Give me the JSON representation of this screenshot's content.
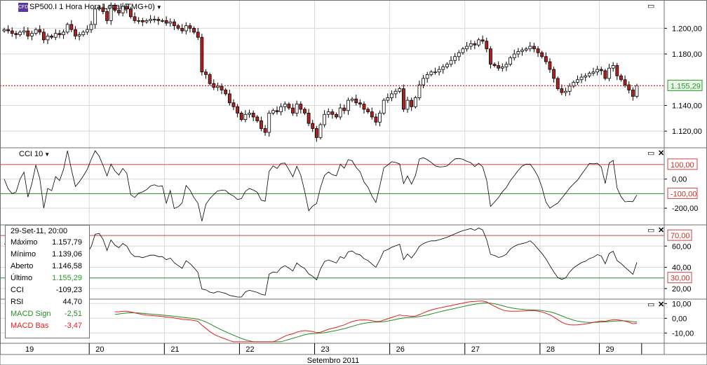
{
  "window": {
    "title": "SP500.I 1 Hora Hora Local (TMG+0)",
    "logo_label": "CFD"
  },
  "price_pane": {
    "last_price_label": "1.155,29"
  },
  "cci_pane": {
    "label": "CCI 10"
  },
  "info_box": {
    "header": "29-Set-11, 20:00",
    "rows": [
      {
        "label": "Máximo",
        "value": "1.157,79",
        "color": "#000000"
      },
      {
        "label": "Mínimo",
        "value": "1.139,06",
        "color": "#000000"
      },
      {
        "label": "Aberto",
        "value": "1.146,58",
        "color": "#000000"
      },
      {
        "label": "Último",
        "value": "1.155,29",
        "color": "#2a9a2a"
      },
      {
        "label": "CCI",
        "value": "-109,23",
        "color": "#000000"
      },
      {
        "label": "RSI",
        "value": "44,70",
        "color": "#000000"
      },
      {
        "label": "MACD Sign",
        "value": "-2,51",
        "color": "#2a8a2a",
        "label_color": "#2a8a2a"
      },
      {
        "label": "MACD Bas",
        "value": "-3,47",
        "color": "#e02020",
        "label_color": "#e02020"
      }
    ]
  },
  "colors": {
    "up_candle": "#ffffff",
    "down_candle": "#b02020",
    "ref_red": "#d04040",
    "ref_green": "#2a8a2a",
    "macd_signal": "#2a8a2a",
    "macd_base": "#e02020"
  },
  "chart_data": [
    {
      "type": "candlestick",
      "title": "SP500.I 1 Hora Hora Local (TMG+0)",
      "y_ticks": [
        "1.120,00",
        "1.140,00",
        "1.160,00",
        "1.180,00",
        "1.200,00"
      ],
      "ylim": [
        1107,
        1222
      ],
      "last_price": 1155.29,
      "x_labels": [
        "19",
        "20",
        "21",
        "22",
        "23",
        "26",
        "27",
        "28",
        "29"
      ],
      "x_title": "Setembro 2011",
      "close": [
        1199,
        1198,
        1196,
        1195,
        1197,
        1198,
        1194,
        1196,
        1199,
        1197,
        1191,
        1194,
        1193,
        1196,
        1195,
        1197,
        1203,
        1199,
        1194,
        1195,
        1197,
        1199,
        1203,
        1215,
        1216,
        1213,
        1206,
        1218,
        1214,
        1212,
        1217,
        1215,
        1209,
        1206,
        1206,
        1205,
        1206,
        1207,
        1207,
        1206,
        1206,
        1204,
        1205,
        1202,
        1200,
        1198,
        1202,
        1200,
        1197,
        1193,
        1166,
        1164,
        1157,
        1154,
        1155,
        1152,
        1149,
        1142,
        1139,
        1134,
        1129,
        1133,
        1134,
        1131,
        1128,
        1122,
        1119,
        1134,
        1136,
        1135,
        1139,
        1141,
        1138,
        1134,
        1141,
        1137,
        1134,
        1126,
        1122,
        1115,
        1125,
        1133,
        1135,
        1133,
        1131,
        1138,
        1136,
        1144,
        1145,
        1142,
        1141,
        1137,
        1135,
        1131,
        1127,
        1134,
        1144,
        1146,
        1149,
        1151,
        1153,
        1137,
        1144,
        1139,
        1146,
        1156,
        1161,
        1164,
        1166,
        1166,
        1168,
        1170,
        1172,
        1175,
        1178,
        1181,
        1184,
        1186,
        1188,
        1187,
        1191,
        1190,
        1184,
        1172,
        1171,
        1169,
        1170,
        1172,
        1177,
        1180,
        1182,
        1183,
        1184,
        1186,
        1184,
        1181,
        1178,
        1174,
        1168,
        1161,
        1153,
        1150,
        1151,
        1155,
        1158,
        1160,
        1162,
        1163,
        1165,
        1166,
        1168,
        1167,
        1161,
        1169,
        1171,
        1163,
        1160,
        1156,
        1152,
        1147,
        1155.29
      ],
      "panes": [
        "price",
        "cci",
        "rsi",
        "macd"
      ]
    },
    {
      "type": "line",
      "title": "CCI 10",
      "y_ticks": [
        "100,00",
        "0,00",
        "-100,00",
        "-200,00"
      ],
      "ylim": [
        -315,
        215
      ],
      "reference_lines": [
        100,
        -100
      ],
      "last_value": -109.23
    },
    {
      "type": "line",
      "title": "RSI",
      "y_ticks": [
        "70,00",
        "60,00",
        "40,00",
        "30,00",
        "20,00"
      ],
      "ylim": [
        10,
        80
      ],
      "reference_lines": [
        70,
        30
      ],
      "last_value": 44.7
    },
    {
      "type": "line",
      "title": "MACD",
      "y_ticks": [
        "10,00",
        "0,00",
        "-10,00"
      ],
      "ylim": [
        -17,
        13
      ],
      "series": [
        {
          "name": "MACD Sign",
          "last_value": -2.51
        },
        {
          "name": "MACD Bas",
          "last_value": -3.47
        }
      ]
    }
  ]
}
